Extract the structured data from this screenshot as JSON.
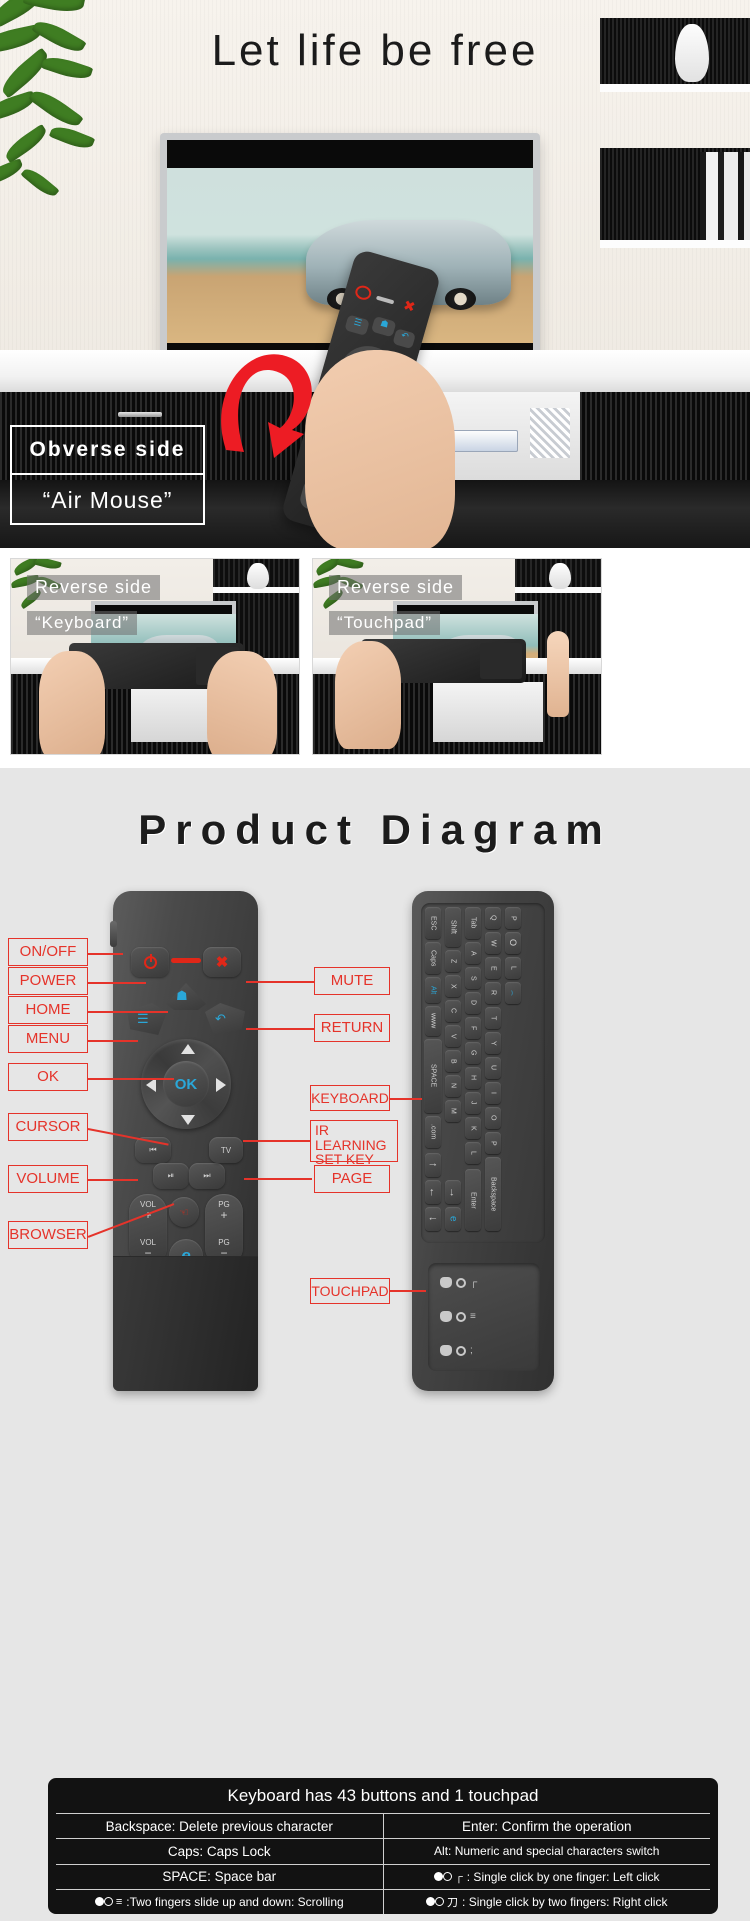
{
  "hero": {
    "title": "Let life be free",
    "obverse_label_line1": "Obverse side",
    "obverse_label_line2": "“Air Mouse”"
  },
  "reverse_panels": [
    {
      "line1": "Reverse side",
      "line2": "“Keyboard”"
    },
    {
      "line1": "Reverse side",
      "line2": "“Touchpad”"
    }
  ],
  "diagram": {
    "title": "Product Diagram",
    "left_callouts": [
      {
        "label": "ON/OFF"
      },
      {
        "label": "POWER"
      },
      {
        "label": "HOME"
      },
      {
        "label": "MENU"
      },
      {
        "label": "OK"
      },
      {
        "label": "CURSOR"
      },
      {
        "label": "VOLUME"
      },
      {
        "label": "BROWSER"
      }
    ],
    "right_callouts": [
      {
        "label": "MUTE"
      },
      {
        "label": "RETURN"
      },
      {
        "label": "KEYBOARD"
      },
      {
        "label": "IR LEARNING\nSET KEY"
      },
      {
        "label": "PAGE"
      },
      {
        "label": "TOUCHPAD"
      }
    ],
    "remote_buttons": {
      "ok": "OK",
      "tv": "TV",
      "vol_up_top": "VOL",
      "vol_up_sign": "+",
      "vol_down_top": "VOL",
      "vol_down_sign": "−",
      "pg_up_top": "PG",
      "pg_up_sign": "+",
      "pg_down_top": "PG",
      "pg_down_sign": "−",
      "browser_glyph": "e"
    },
    "keyboard_keys_col1": [
      "ESC",
      "Caps",
      "Alt",
      "www",
      "SPACE",
      ".com"
    ],
    "keyboard_keys_col2": [
      "Shift",
      "Z",
      "X",
      "C",
      "V",
      "B",
      "N",
      "M"
    ],
    "keyboard_keys_col3": [
      "Tab",
      "A",
      "S",
      "D",
      "F",
      "G",
      "H",
      "J",
      "K",
      "L"
    ],
    "keyboard_keys_col4": [
      "Q",
      "W",
      "E",
      "R",
      "T",
      "Y",
      "U",
      "I",
      "O",
      "P"
    ],
    "keyboard_nav_keys": [
      "↑",
      "←",
      "→",
      "↓",
      "Enter",
      "Backspace"
    ]
  },
  "info_table": {
    "heading": "Keyboard has 43 buttons and 1 touchpad",
    "rows": [
      {
        "left": "Backspace: Delete previous character",
        "right": "Enter: Confirm the operation",
        "left_gesture": "",
        "right_gesture": ""
      },
      {
        "left": "Caps: Caps Lock",
        "right": "Alt: Numeric and special characters switch",
        "left_gesture": "",
        "right_gesture": ""
      },
      {
        "left": "SPACE: Space bar",
        "right": ": Single click by one finger: Left click",
        "left_gesture": "",
        "right_gesture": "┌"
      },
      {
        "left": ":Two fingers slide up and down: Scrolling",
        "right": ": Single click by two fingers: Right click",
        "left_gesture": "≡",
        "right_gesture": "刀"
      }
    ]
  },
  "colors": {
    "callout_red": "#e5332a",
    "accent_blue": "#2aa7d8",
    "diagram_bg": "#e6e6e6",
    "info_bg": "#121212"
  }
}
